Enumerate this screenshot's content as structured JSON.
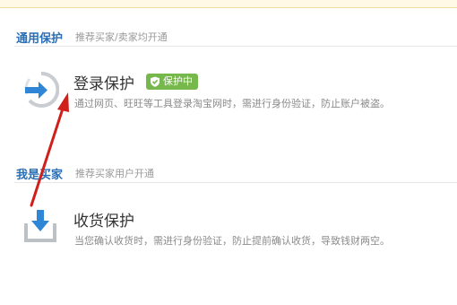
{
  "sections": [
    {
      "title": "通用保护",
      "subtitle": "推荐买家/卖家均开通",
      "item": {
        "title": "登录保护",
        "badge": "保护中",
        "description": "通过网页、旺旺等工具登录淘宝网时，需进行身份验证，防止账户被盗。",
        "icon": "login-arrow-icon"
      }
    },
    {
      "title": "我是买家",
      "subtitle": "推荐买家用户开通",
      "item": {
        "title": "收货保护",
        "description": "当您确认收货时，需进行身份验证，防止提前确认收货，导致钱财两空。",
        "icon": "receive-download-icon"
      }
    }
  ],
  "annotation": {
    "color": "#d0201c"
  },
  "colors": {
    "accent": "#2a6fb6",
    "badge": "#76b84c"
  }
}
